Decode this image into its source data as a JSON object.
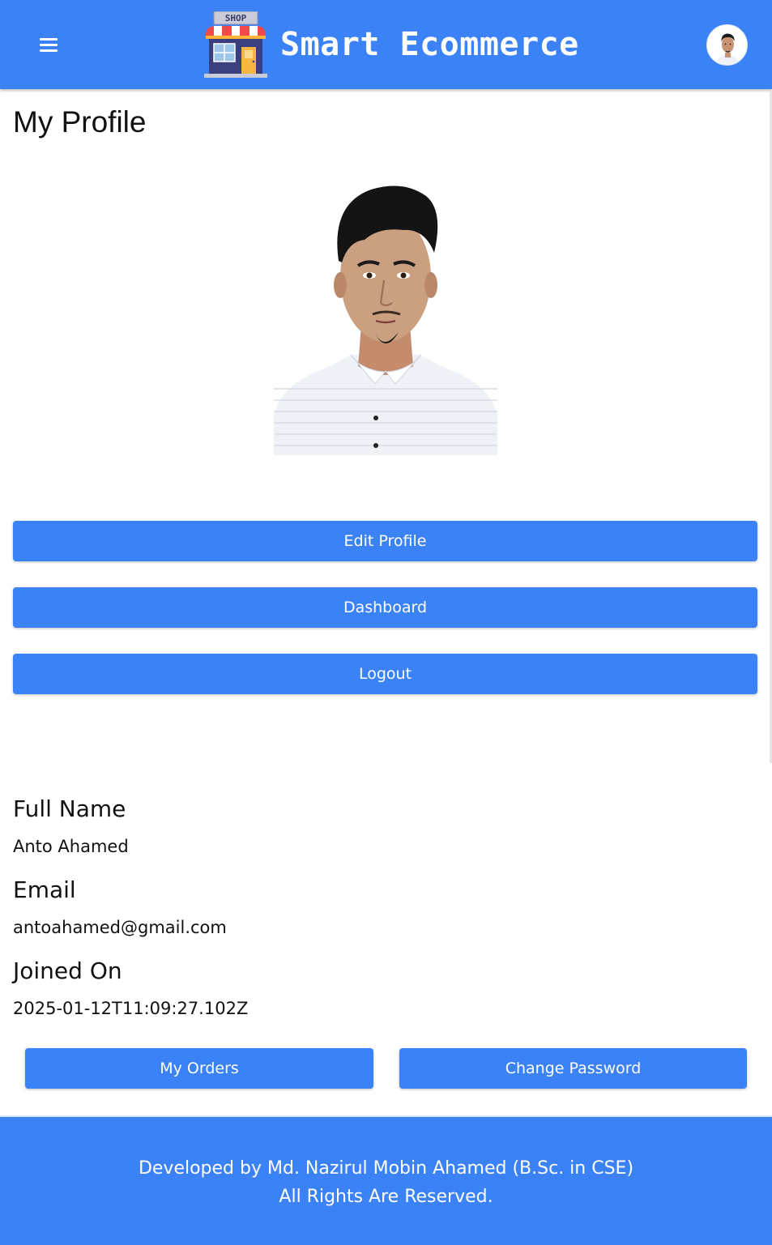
{
  "header": {
    "brand_title": "Smart Ecommerce",
    "logo_sign": "SHOP",
    "menu_icon": "hamburger-menu-icon",
    "avatar_icon": "user-avatar"
  },
  "main": {
    "title": "My Profile",
    "photo": "profile-photo",
    "buttons": {
      "edit_profile": "Edit Profile",
      "dashboard": "Dashboard",
      "logout": "Logout"
    },
    "details": {
      "full_name_label": "Full Name",
      "full_name_value": "Anto Ahamed",
      "email_label": "Email",
      "email_value": "antoahamed@gmail.com",
      "joined_label": "Joined On",
      "joined_value": "2025-01-12T11:09:27.102Z"
    },
    "actions": {
      "my_orders": "My Orders",
      "change_password": "Change Password"
    }
  },
  "footer": {
    "credit": "Developed by Md. Nazirul Mobin Ahamed (B.Sc. in CSE)",
    "rights": "All Rights Are Reserved."
  },
  "colors": {
    "primary": "#3b82f6",
    "text": "#111111",
    "background": "#ffffff"
  }
}
